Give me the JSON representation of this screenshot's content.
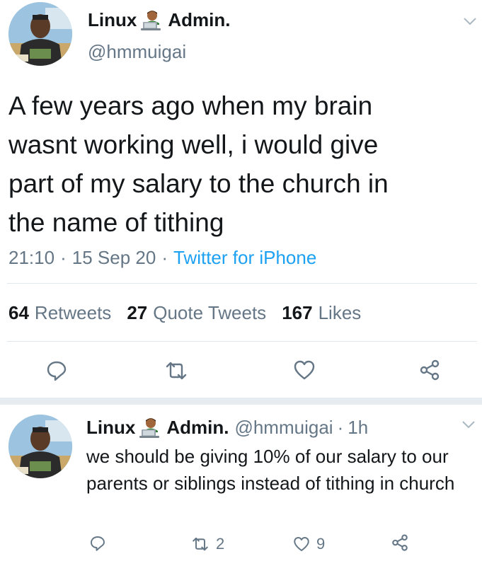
{
  "colors": {
    "text": "#14171a",
    "secondary": "#657786",
    "link": "#1da1f2",
    "divider": "#e1e8ed"
  },
  "main_tweet": {
    "display_name_part1": "Linux",
    "display_name_part2": "Admin.",
    "name_emoji": "technologist-emoji",
    "handle": "@hmmuigai",
    "text": "A few years ago when my brain\nwasnt working well, i would give\npart of my salary to the church in\nthe name of tithing",
    "time": "21:10",
    "date": "15 Sep 20",
    "source": "Twitter for iPhone",
    "retweets_count": "64",
    "retweets_label": "Retweets",
    "quote_tweets_count": "27",
    "quote_tweets_label": "Quote Tweets",
    "likes_count": "167",
    "likes_label": "Likes"
  },
  "reply_tweet": {
    "display_name_part1": "Linux",
    "display_name_part2": "Admin.",
    "handle": "@hmmuigai",
    "time": "1h",
    "text": "we should be giving 10% of our salary to our parents or siblings instead of tithing in church",
    "retweets_count": "2",
    "likes_count": "9"
  }
}
